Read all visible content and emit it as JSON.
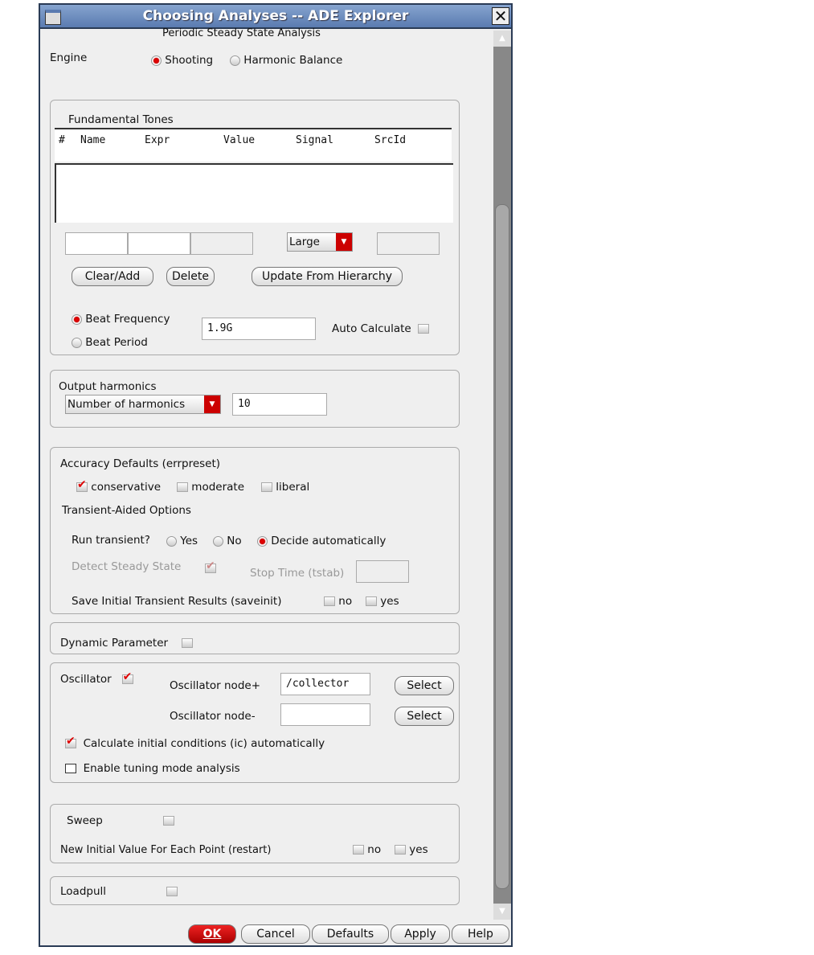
{
  "window": {
    "title": "Choosing Analyses -- ADE Explorer"
  },
  "header": "Periodic Steady State Analysis",
  "engine": {
    "label": "Engine",
    "options": [
      "Shooting",
      "Harmonic Balance"
    ],
    "selected": "Shooting"
  },
  "tones": {
    "title": "Fundamental Tones",
    "columns": [
      "#",
      "Name",
      "Expr",
      "Value",
      "Signal",
      "SrcId"
    ],
    "size_select": "Large",
    "buttons": [
      "Clear/Add",
      "Delete",
      "Update From Hierarchy"
    ],
    "beat_frequency": "Beat Frequency",
    "beat_period": "Beat Period",
    "beat_value": "1.9G",
    "auto_calc": "Auto Calculate"
  },
  "harmonics": {
    "title": "Output harmonics",
    "select": "Number of harmonics",
    "value": "10"
  },
  "accuracy": {
    "title": "Accuracy Defaults (errpreset)",
    "options": [
      "conservative",
      "moderate",
      "liberal"
    ],
    "transient_title": "Transient-Aided Options",
    "run_label": "Run transient?",
    "run_options": [
      "Yes",
      "No",
      "Decide automatically"
    ],
    "detect": "Detect Steady State",
    "stop_time": "Stop Time (tstab)",
    "saveinit": "Save Initial Transient Results (saveinit)",
    "no": "no",
    "yes": "yes"
  },
  "dynamic": {
    "label": "Dynamic Parameter"
  },
  "oscillator": {
    "label": "Oscillator",
    "node_plus": "Oscillator node+",
    "node_plus_value": "/collector",
    "node_minus": "Oscillator node-",
    "select": "Select",
    "calc_ic": "Calculate initial conditions (ic) automatically",
    "tuning": "Enable tuning mode analysis"
  },
  "sweep": {
    "label": "Sweep",
    "restart": "New Initial Value For Each Point (restart)",
    "no": "no",
    "yes": "yes"
  },
  "loadpull": {
    "label": "Loadpull"
  },
  "footer": {
    "ok": "OK",
    "cancel": "Cancel",
    "defaults": "Defaults",
    "apply": "Apply",
    "help": "Help"
  }
}
